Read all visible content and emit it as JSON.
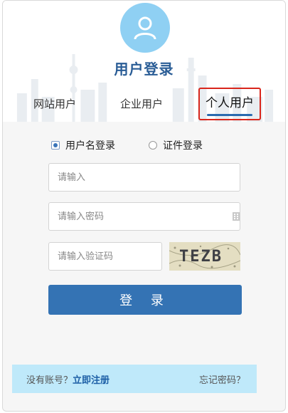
{
  "header": {
    "title": "用户登录",
    "avatar_icon": "user-icon"
  },
  "tabs": [
    {
      "label": "网站用户",
      "active": false
    },
    {
      "label": "企业用户",
      "active": false
    },
    {
      "label": "个人用户",
      "active": true
    }
  ],
  "login_type": [
    {
      "label": "用户名登录",
      "checked": true
    },
    {
      "label": "证件登录",
      "checked": false
    }
  ],
  "form": {
    "username_placeholder": "请输入",
    "password_placeholder": "请输入密码",
    "captcha_placeholder": "请输入验证码",
    "captcha_text": "TEZB",
    "submit_label": "登 录"
  },
  "footer": {
    "no_account": "没有账号？",
    "register": "立即注册",
    "forgot": "忘记密码？"
  },
  "colors": {
    "primary": "#3473b4",
    "title": "#2a5d96",
    "highlight": "#d9261c",
    "footer_bg": "#bfe9fa"
  }
}
